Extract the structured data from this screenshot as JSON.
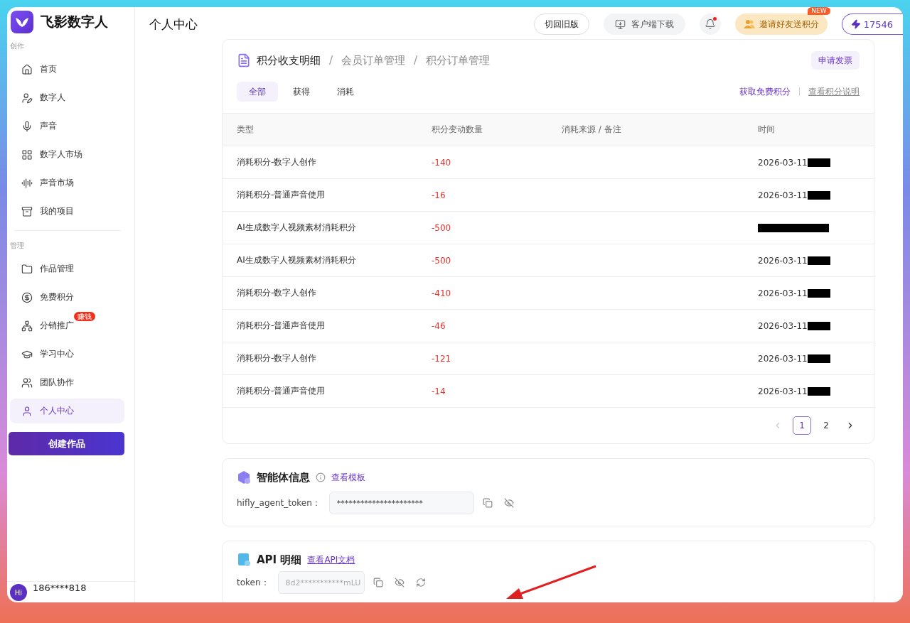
{
  "app": {
    "name": "飞影数字人"
  },
  "sidebar": {
    "sections": [
      {
        "label": "创作",
        "items": [
          {
            "label": "首页",
            "selected": false
          },
          {
            "label": "数字人",
            "selected": false
          },
          {
            "label": "声音",
            "selected": false
          },
          {
            "label": "数字人市场",
            "selected": false
          },
          {
            "label": "声音市场",
            "selected": false
          },
          {
            "label": "我的项目",
            "selected": false
          }
        ]
      },
      {
        "label": "管理",
        "items": [
          {
            "label": "作品管理",
            "selected": false
          },
          {
            "label": "免费积分",
            "selected": false
          },
          {
            "label": "分销推广",
            "selected": false,
            "badge": "赚钱"
          },
          {
            "label": "学习中心",
            "selected": false
          },
          {
            "label": "团队协作",
            "selected": false
          },
          {
            "label": "个人中心",
            "selected": true
          }
        ]
      }
    ],
    "create_button": "创建作品",
    "user": {
      "avatar": "Hi",
      "phone": "186****818"
    }
  },
  "header": {
    "title": "个人中心",
    "old_version": "切回旧版",
    "download": "客户端下载",
    "notifications_unread": true,
    "invite": "邀请好友送积分",
    "invite_badge": "NEW",
    "points": "17546"
  },
  "points_card": {
    "breadcrumb_separator": "/",
    "breadcrumb": [
      {
        "label": "积分收支明细",
        "selected": true
      },
      {
        "label": "会员订单管理",
        "selected": false
      },
      {
        "label": "积分订单管理",
        "selected": false
      }
    ],
    "invoice_button": "申请发票",
    "tabs": [
      {
        "label": "全部",
        "selected": true
      },
      {
        "label": "获得",
        "selected": false
      },
      {
        "label": "消耗",
        "selected": false
      }
    ],
    "links": [
      {
        "label": "获取免费积分",
        "kind": "primary"
      },
      {
        "label": "查看积分说明",
        "kind": "muted"
      }
    ],
    "columns": [
      "类型",
      "积分变动数量",
      "消耗来源 / 备注",
      "时间"
    ],
    "rows": [
      {
        "type": "消耗积分-数字人创作",
        "amount": "-140",
        "time": "2026-03-11",
        "redacted": true
      },
      {
        "type": "消耗积分-普通声音使用",
        "amount": "-16",
        "time": "2026-03-11",
        "redacted": true
      },
      {
        "type": "AI生成数字人视频素材消耗积分",
        "amount": "-500",
        "redacted": true
      },
      {
        "type": "AI生成数字人视频素材消耗积分",
        "amount": "-500",
        "time": "2026-03-11",
        "redacted": true
      },
      {
        "type": "消耗积分-数字人创作",
        "amount": "-410",
        "time": "2026-03-11",
        "redacted": true
      },
      {
        "type": "消耗积分-普通声音使用",
        "amount": "-46",
        "time": "2026-03-11",
        "redacted": true
      },
      {
        "type": "消耗积分-数字人创作",
        "amount": "-121",
        "time": "2026-03-11",
        "redacted": true
      },
      {
        "type": "消耗积分-普通声音使用",
        "amount": "-14",
        "time": "2026-03-11",
        "redacted": true
      }
    ],
    "pagination": {
      "prev_disabled": true,
      "pages": [
        {
          "label": "1",
          "selected": true
        },
        {
          "label": "2",
          "selected": false
        }
      ]
    }
  },
  "agent_card": {
    "title": "智能体信息",
    "link": "查看模板",
    "field_label": "hifly_agent_token：",
    "field_value": "**********************"
  },
  "api_card": {
    "title": "API 明细",
    "link": "查看API文档",
    "field_label": "token：",
    "field_value": "8d2***********mLU"
  },
  "annotation_arrow": true
}
